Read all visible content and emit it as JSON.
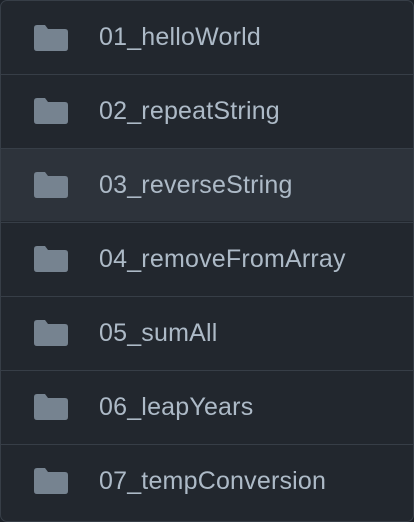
{
  "folders": [
    {
      "name": "01_helloWorld",
      "icon": "folder-icon"
    },
    {
      "name": "02_repeatString",
      "icon": "folder-icon"
    },
    {
      "name": "03_reverseString",
      "icon": "folder-icon",
      "state": "hovered"
    },
    {
      "name": "04_removeFromArray",
      "icon": "folder-icon"
    },
    {
      "name": "05_sumAll",
      "icon": "folder-icon"
    },
    {
      "name": "06_leapYears",
      "icon": "folder-icon"
    },
    {
      "name": "07_tempConversion",
      "icon": "folder-icon"
    }
  ],
  "colors": {
    "background": "#22272e",
    "hover_row": "#2d333b",
    "border": "#373e47",
    "icon": "#768390",
    "text": "#adbac7"
  }
}
